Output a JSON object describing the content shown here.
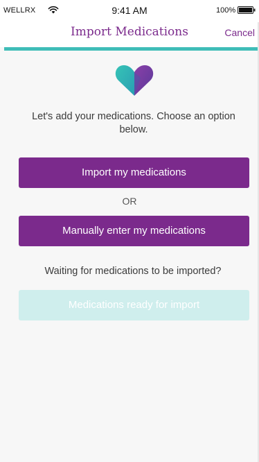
{
  "status_bar": {
    "carrier": "WELLRX",
    "time": "9:41 AM",
    "battery": "100%"
  },
  "nav": {
    "title": "Import Medications",
    "cancel_label": "Cancel"
  },
  "colors": {
    "brand_purple": "#7b2a8c",
    "accent_teal": "#3fbdb8",
    "disabled_teal": "#cfeeed"
  },
  "icons": {
    "logo": "heart-icon",
    "wifi": "wifi-icon",
    "battery": "battery-icon"
  },
  "content": {
    "intro": "Let's add your medications. Choose an option below.",
    "import_button": "Import my medications",
    "or_label": "OR",
    "manual_button": "Manually enter my medications",
    "waiting_text": "Waiting for medications to be imported?",
    "ready_button": "Medications ready for import"
  }
}
